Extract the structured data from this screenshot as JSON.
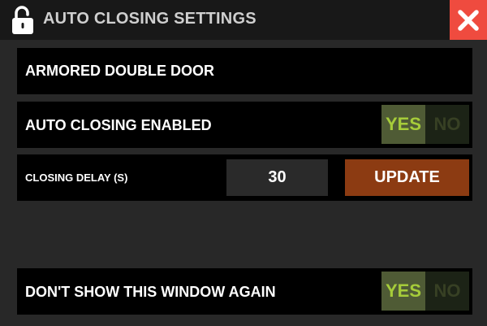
{
  "window": {
    "title": "AUTO CLOSING SETTINGS",
    "lock_icon": "lock-open-icon",
    "close_icon": "close-icon"
  },
  "door_name": "ARMORED DOUBLE DOOR",
  "auto_closing": {
    "label": "AUTO CLOSING ENABLED",
    "yes_label": "YES",
    "no_label": "NO",
    "selected": "YES"
  },
  "closing_delay": {
    "label": "CLOSING DELAY (S)",
    "value": "30",
    "update_label": "UPDATE"
  },
  "dont_show": {
    "label": "DON'T SHOW THIS WINDOW AGAIN",
    "yes_label": "YES",
    "no_label": "NO",
    "selected": "YES"
  },
  "colors": {
    "close_button": "#ef4b3f",
    "update_button": "#8c3b12",
    "toggle_yes_bg": "#4f5b35",
    "toggle_yes_text": "#a6cc3a",
    "toggle_no_bg": "#1c2316",
    "toggle_no_text": "#374024"
  }
}
